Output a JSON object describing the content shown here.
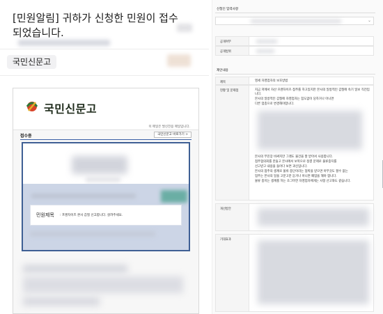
{
  "email": {
    "title": "[민원알림] 귀하가 신청한 민원이 접수되었습니다.",
    "category_chip": "국민신문고"
  },
  "mail_body": {
    "logo_text": "국민신문고",
    "notice": "이 메일은 발신전용 메일입니다.",
    "status_label": "접수중",
    "shortcut_button": "국민신문고 바로가기 >",
    "petition_label": "민원제목",
    "petition_title": ": 프랜차이즈 본사 갑질 신고합니다. 살려주세요."
  },
  "form": {
    "section_agency": "신청인 입력사항",
    "row_label_1": "공개여부",
    "row_label_2": "공개범위",
    "section_content": "제안내용",
    "subject_label": "제목",
    "subject_value": "영세 자영업자의 보호방법",
    "status_label": "현황 및 문제점",
    "status_text_1": "지금 저에서 자산 프랜차이즈 점주를 하고있지만 본사의 일방적인 갑질에 속기 일보 직전입니다.",
    "status_text_2": "본사의 일방적인 갑질에 자영업자는 힘도없이 당하거나 아니면",
    "status_text_3": "다른 업종으로 변경해야합니다.",
    "status_text_4": "본사의 무진장 비싸지만 그래도 물건을 잘 받아서 사용합니다.",
    "status_text_5": "점주협의회를 만들고 본사에서 보복으로 정결 문제로 물류중지를",
    "status_text_6": "선고받고 내용을 들어다 보면 과신입니다.",
    "status_text_7": "본사의 점주의 생계로 물류 중단이라는 협박을 받으면 아무것도 할수 없는",
    "status_text_8": "업주는 본사의 일을 고분고분 듣거나 아니면 폐업을 해야 합니다.",
    "status_text_9": "물류 중지는 생계를 하는 조그마한 자영업자에게는 사형 선고와도 같습니다.",
    "improve_label": "개선방안",
    "effect_label": "기대효과"
  }
}
